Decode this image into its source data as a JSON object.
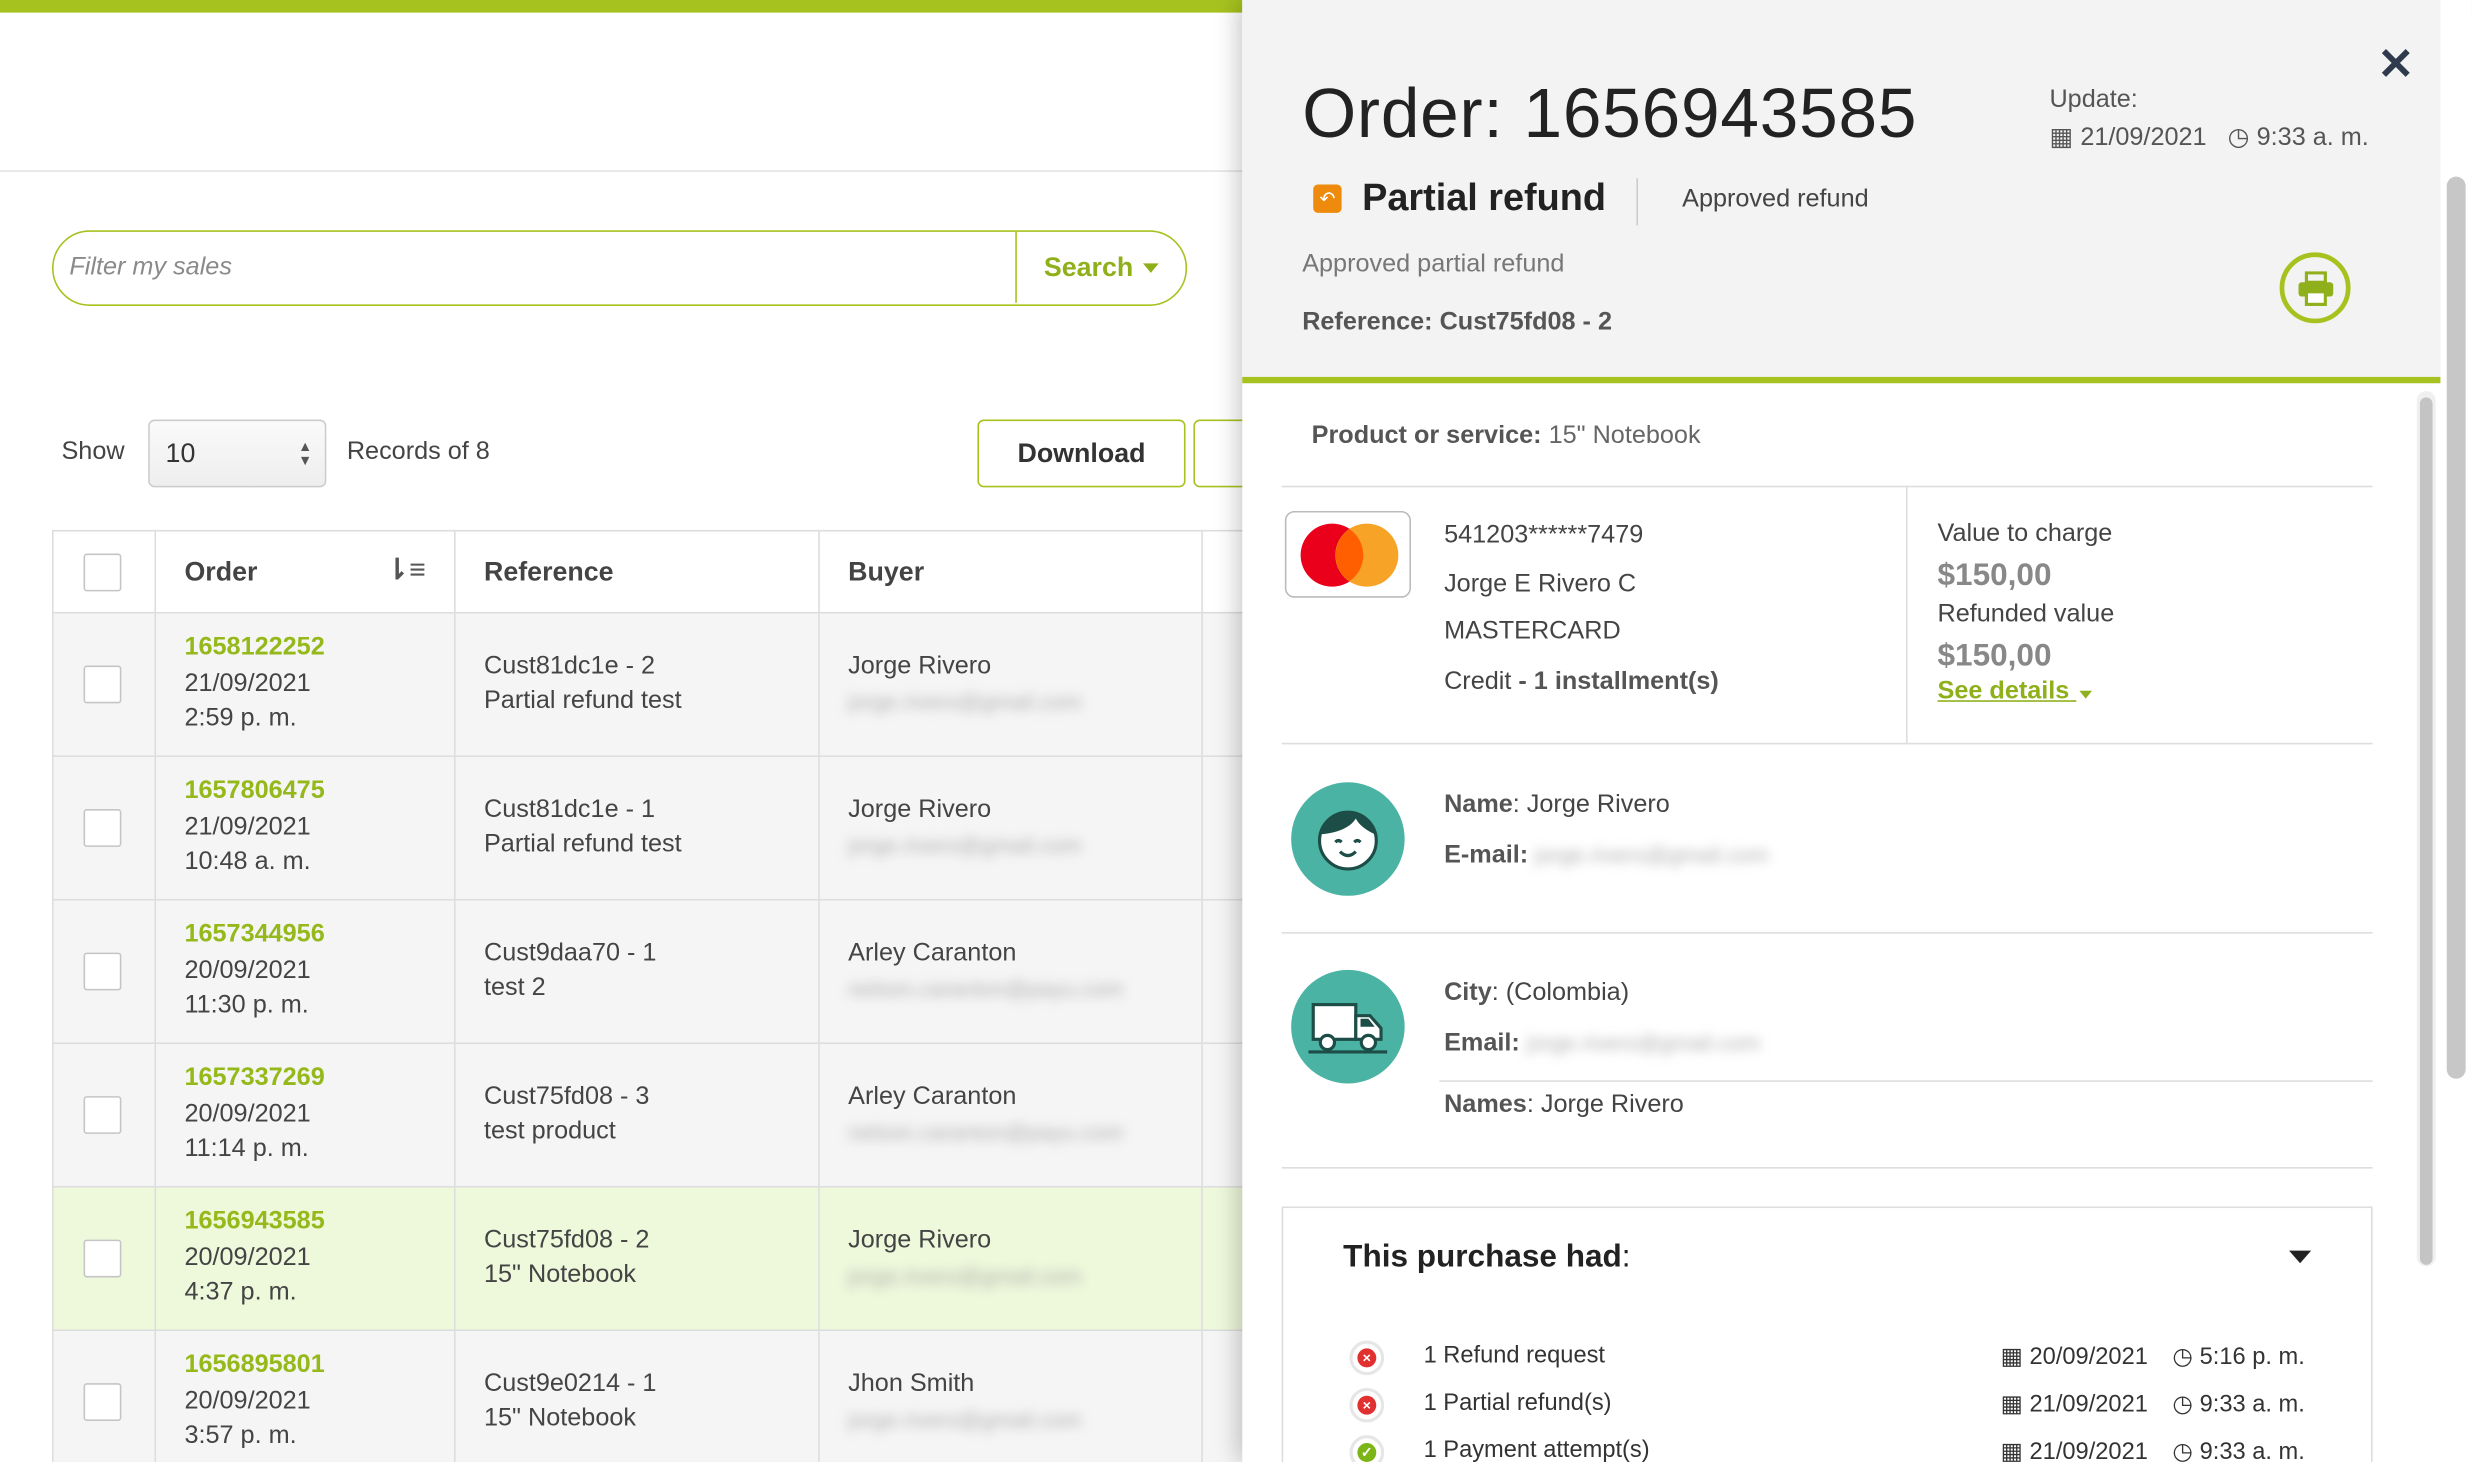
{
  "colors": {
    "accent": "#a6c21f",
    "teal": "#4bb3a3",
    "refund_orange": "#ee8a0c",
    "error_red": "#e03030",
    "success_green": "#7db519"
  },
  "search": {
    "placeholder": "Filter my sales",
    "button": "Search"
  },
  "controls": {
    "show_label": "Show",
    "page_size": "10",
    "records_label": "Records of 8",
    "download_label": "Download"
  },
  "table": {
    "columns": [
      "Order",
      "Reference",
      "Buyer"
    ],
    "rows": [
      {
        "order": "1658122252",
        "date": "21/09/2021",
        "time": "2:59 p. m.",
        "ref": "Cust81dc1e - 2",
        "desc": "Partial refund test",
        "buyer": "Jorge Rivero",
        "email": "jorge.rivero@gmail.com"
      },
      {
        "order": "1657806475",
        "date": "21/09/2021",
        "time": "10:48 a. m.",
        "ref": "Cust81dc1e - 1",
        "desc": "Partial refund test",
        "buyer": "Jorge Rivero",
        "email": "jorge.rivero@gmail.com"
      },
      {
        "order": "1657344956",
        "date": "20/09/2021",
        "time": "11:30 p. m.",
        "ref": "Cust9daa70 - 1",
        "desc": "test 2",
        "buyer": "Arley Caranton",
        "email": "nelson.caranton@payu.com"
      },
      {
        "order": "1657337269",
        "date": "20/09/2021",
        "time": "11:14 p. m.",
        "ref": "Cust75fd08 - 3",
        "desc": "test product",
        "buyer": "Arley Caranton",
        "email": "nelson.caranton@payu.com"
      },
      {
        "order": "1656943585",
        "date": "20/09/2021",
        "time": "4:37 p. m.",
        "ref": "Cust75fd08 - 2",
        "desc": "15\" Notebook",
        "buyer": "Jorge Rivero",
        "email": "jorge.rivero@gmail.com"
      },
      {
        "order": "1656895801",
        "date": "20/09/2021",
        "time": "3:57 p. m.",
        "ref": "Cust9e0214 - 1",
        "desc": "15\" Notebook",
        "buyer": "Jhon Smith",
        "email": "jorge.rivero@gmail.com"
      }
    ]
  },
  "panel": {
    "title": "Order: 1656943585",
    "update_label": "Update:",
    "update_date": "21/09/2021",
    "update_time": "9:33 a. m.",
    "status": "Partial refund",
    "status_detail": "Approved refund",
    "subtitle": "Approved partial refund",
    "reference": "Reference: Cust75fd08 - 2",
    "product_label": "Product or service:",
    "product_value": "15\" Notebook",
    "card_number": "541203******7479",
    "card_holder": "Jorge E Rivero C",
    "card_brand": "MASTERCARD",
    "payment_type": "Credit",
    "installments": "- 1 installment(s)",
    "value_label": "Value to charge",
    "value_amount": "$150,00",
    "refunded_label": "Refunded value",
    "refunded_amount": "$150,00",
    "see_details": "See details",
    "buyer_name_label": "Name",
    "buyer_name": ": Jorge Rivero",
    "buyer_email_label": "E-mail:",
    "buyer_email": "jorge.rivero@gmail.com",
    "ship_city_label": "City",
    "ship_city": ": (Colombia)",
    "ship_email_label": "Email:",
    "ship_email": "jorge.rivero@gmail.com",
    "ship_names_label": "Names",
    "ship_names": ": Jorge Rivero",
    "history_title": "This purchase had",
    "history_colon": ":",
    "history": [
      {
        "label": "1 Refund request",
        "date": "20/09/2021",
        "time": "5:16 p. m.",
        "status": "error"
      },
      {
        "label": "1 Partial refund(s)",
        "date": "21/09/2021",
        "time": "9:33 a. m.",
        "status": "error"
      },
      {
        "label": "1 Payment attempt(s)",
        "date": "21/09/2021",
        "time": "9:33 a. m.",
        "status": "success"
      }
    ]
  }
}
